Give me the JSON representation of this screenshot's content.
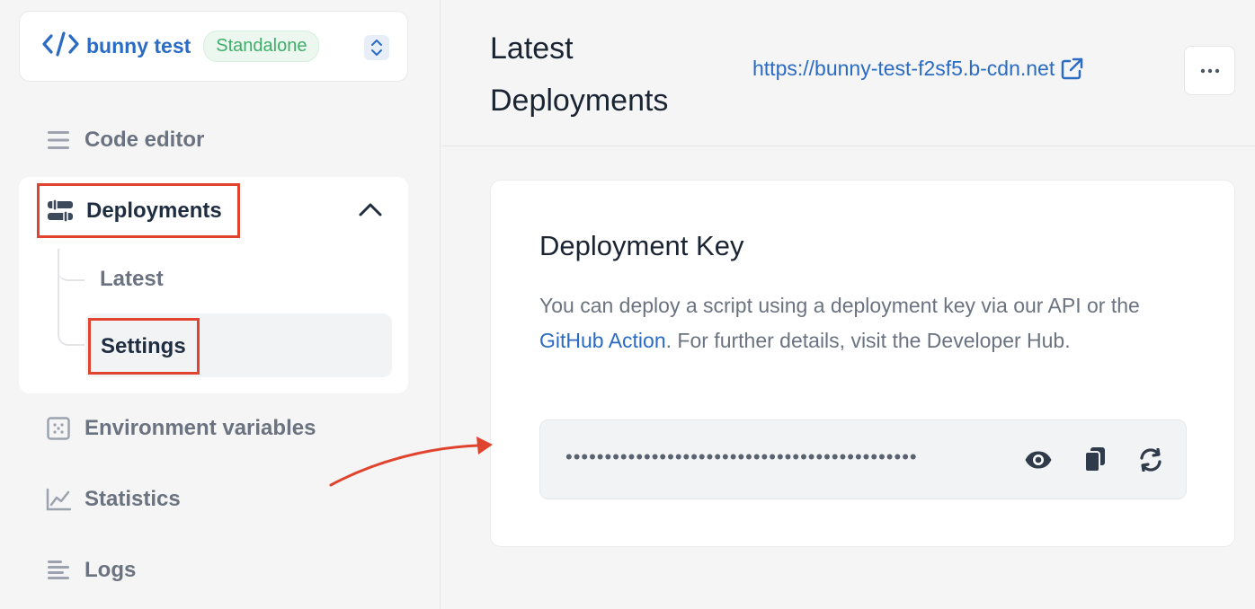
{
  "project": {
    "name": "bunny test",
    "badge": "Standalone"
  },
  "sidebar": {
    "items": [
      {
        "label": "Code editor",
        "icon": "menu-lines-icon"
      },
      {
        "label": "Deployments",
        "icon": "sliders-icon",
        "expanded": true,
        "children": [
          {
            "label": "Latest"
          },
          {
            "label": "Settings",
            "active": true
          }
        ]
      },
      {
        "label": "Environment variables",
        "icon": "grid-icon"
      },
      {
        "label": "Statistics",
        "icon": "chart-icon"
      },
      {
        "label": "Logs",
        "icon": "list-icon"
      }
    ]
  },
  "header": {
    "title": "Latest Deployments",
    "url": "https://bunny-test-f2sf5.b-cdn.net",
    "more_label": "•••"
  },
  "card": {
    "title": "Deployment Key",
    "desc_before": "You can deploy a script using a deployment key via our API or the ",
    "desc_link": "GitHub Action",
    "desc_after": ". For further details, visit the Developer Hub.",
    "key_masked": "•••••••••••••••••••••••••••••••••••••••••••••"
  },
  "colors": {
    "accent": "#2a6bc4",
    "highlight": "#e0432e",
    "badge_text": "#3fae6a"
  }
}
